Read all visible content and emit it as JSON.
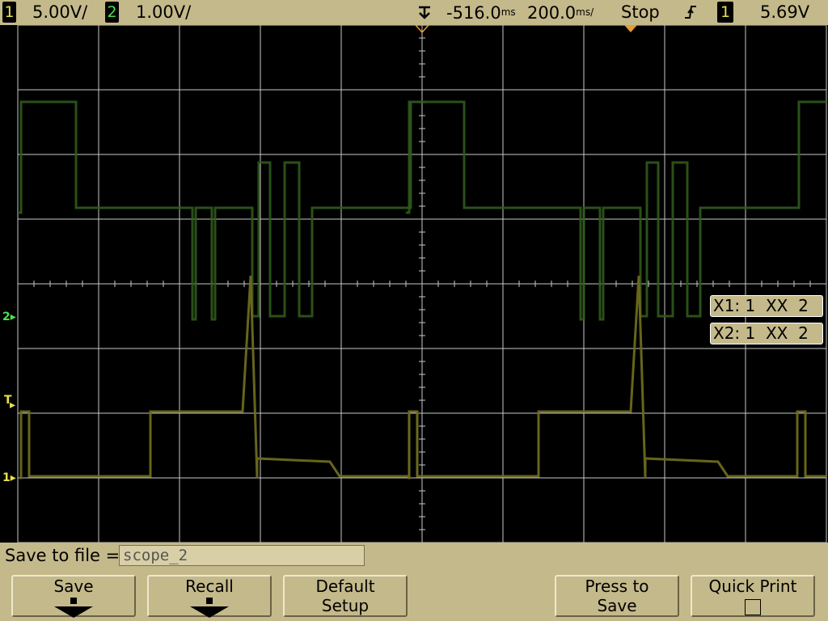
{
  "status_bar": {
    "ch1_num": "1",
    "ch1_scale": "5.00V/",
    "ch2_num": "2",
    "ch2_scale": "1.00V/",
    "delay_value": "-516.0",
    "delay_unit": "ms",
    "timebase_value": "200.0",
    "timebase_unit": "ms/",
    "run_state": "Stop",
    "trigger_source": "1",
    "trigger_level": "5.69V"
  },
  "markers": {
    "ch2": "2",
    "trigger": "T",
    "ch1": "1"
  },
  "cursors": {
    "x1": "X1: 1  XX  2",
    "x2": "X2: 1  XX  2"
  },
  "save": {
    "label": "Save to file =",
    "filename": "scope_2"
  },
  "softkeys": {
    "save": "Save",
    "recall": "Recall",
    "default_line1": "Default",
    "default_line2": "Setup",
    "press_line1": "Press to",
    "press_line2": "Save",
    "quick_print": "Quick Print"
  },
  "colors": {
    "ch1": "#6b6a1c",
    "ch2": "#2f5a1c",
    "grid": "#c8c8c8",
    "bezel": "#c4b98a"
  }
}
